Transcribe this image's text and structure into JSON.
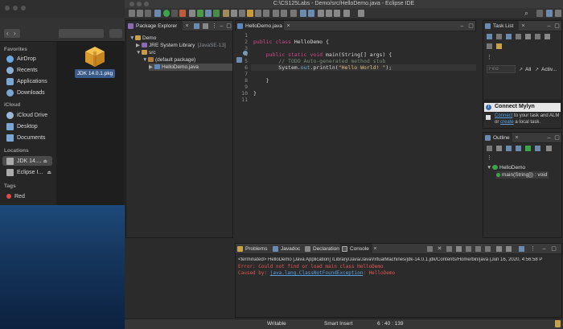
{
  "finder": {
    "favorites_header": "Favorites",
    "favorites": [
      "AirDrop",
      "Recents",
      "Applications",
      "Downloads"
    ],
    "icloud_header": "iCloud",
    "icloud": [
      "iCloud Drive",
      "Desktop",
      "Documents"
    ],
    "locations_header": "Locations",
    "locations": [
      "JDK 14....",
      "Eclipse I..."
    ],
    "tags_header": "Tags",
    "tags": [
      "Red"
    ],
    "file_label": "JDK 14.0.1.pkg"
  },
  "eclipse": {
    "window_title": "C:\\CS125Labs - Demo/src/HelloDemo.java - Eclipse IDE",
    "package_explorer": {
      "tab": "Package Explorer",
      "tree": [
        {
          "label": "Demo",
          "arrow": "▼",
          "indent": 0,
          "icon_color": "#c8a24a"
        },
        {
          "label": "JRE System Library",
          "decor": "[JavaSE-13]",
          "arrow": "▶",
          "indent": 1,
          "icon_color": "#8a6ab0"
        },
        {
          "label": "src",
          "arrow": "▼",
          "indent": 1,
          "icon_color": "#c89a4a"
        },
        {
          "label": "(default package)",
          "arrow": "▼",
          "indent": 2,
          "icon_color": "#b07a3a"
        },
        {
          "label": "HelloDemo.java",
          "arrow": "▶",
          "indent": 3,
          "icon_color": "#5a8ac0",
          "selected": true
        }
      ]
    },
    "editor": {
      "tab": "HelloDemo.java",
      "line_numbers": [
        "1",
        "2",
        "3",
        "4",
        "5",
        "6",
        "7",
        "8",
        "9",
        "10",
        "11"
      ],
      "code": {
        "l1_kw": "public class ",
        "l1_name": "HelloDemo {",
        "l4_kw": "    public static void ",
        "l4_rest": "main(String[] args) {",
        "l5": "        // TODO Auto-generated method stub",
        "l6_a": "        System.",
        "l6_b": "out",
        "l6_c": ".println(",
        "l6_d": "\"Hello World! \"",
        "l6_e": ");",
        "l8": "    }",
        "l10": "}"
      }
    },
    "task_list": {
      "tab": "Task List",
      "find_placeholder": "Find",
      "all_label": "All",
      "activate_label": "Activ...",
      "mylyn_title": "Connect Mylyn",
      "mylyn_link1": "Connect",
      "mylyn_text1": " to your task and ALM",
      "mylyn_text2": "or ",
      "mylyn_link2": "create",
      "mylyn_text3": " a local task."
    },
    "outline": {
      "tab": "Outline",
      "class_name": "HelloDemo",
      "method": "main(String[]) : void"
    },
    "bottom_tabs": [
      "Problems",
      "Javadoc",
      "Declaration",
      "Console"
    ],
    "console": {
      "terminated_line": "<terminated> HelloDemo [Java Application] /Library/Java/JavaVirtualMachines/jdk-14.0.1.jdk/Contents/Home/bin/java  (Jun 16, 2020, 4:56:58 P",
      "error_line": "Error: Could not find or load main class HelloDemo",
      "caused_prefix": "Caused by: ",
      "caused_link": "java.lang.ClassNotFoundException",
      "caused_suffix": ": HelloDemo"
    },
    "status": {
      "writable": "Writable",
      "insert_mode": "Smart Insert",
      "position": "6 : 40 : 139"
    }
  },
  "colors": {
    "error_red": "#e05555",
    "link_blue": "#5aa0e0",
    "keyword": "#d14a8a",
    "string": "#e6c07b"
  }
}
